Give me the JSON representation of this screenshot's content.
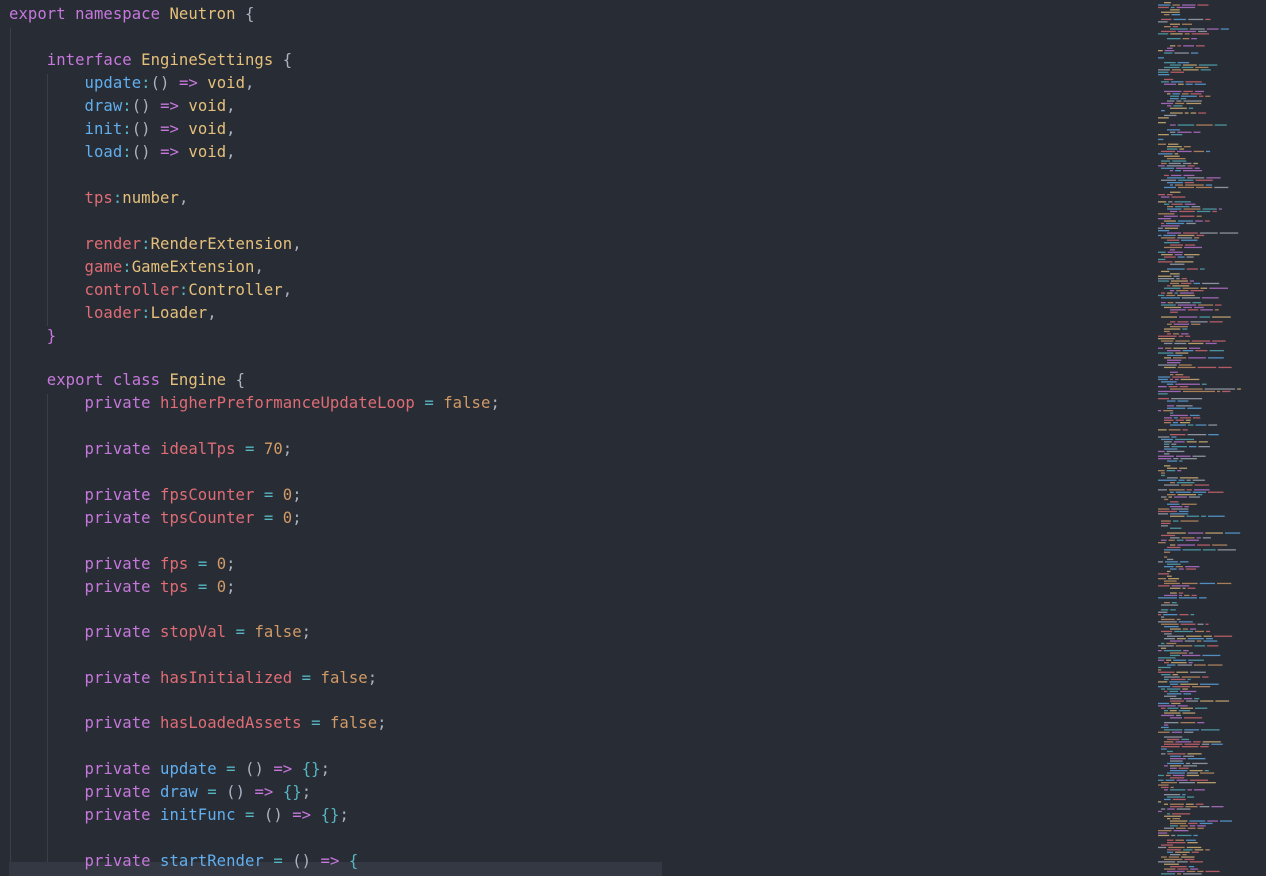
{
  "editor": {
    "language": "typescript",
    "lines": [
      [
        [
          "k",
          "export "
        ],
        [
          "k",
          "namespace "
        ],
        [
          "t",
          "Neutron "
        ],
        [
          "b",
          "{"
        ]
      ],
      [],
      [
        [
          "b",
          "    "
        ],
        [
          "k",
          "interface "
        ],
        [
          "t",
          "EngineSettings "
        ],
        [
          "b",
          "{"
        ]
      ],
      [
        [
          "b",
          "        "
        ],
        [
          "f",
          "update"
        ],
        [
          "o",
          ":"
        ],
        [
          "b",
          "() "
        ],
        [
          "k",
          "=>"
        ],
        [
          "b",
          " "
        ],
        [
          "t",
          "void"
        ],
        [
          "b",
          ","
        ]
      ],
      [
        [
          "b",
          "        "
        ],
        [
          "f",
          "draw"
        ],
        [
          "o",
          ":"
        ],
        [
          "b",
          "() "
        ],
        [
          "k",
          "=>"
        ],
        [
          "b",
          " "
        ],
        [
          "t",
          "void"
        ],
        [
          "b",
          ","
        ]
      ],
      [
        [
          "b",
          "        "
        ],
        [
          "f",
          "init"
        ],
        [
          "o",
          ":"
        ],
        [
          "b",
          "() "
        ],
        [
          "k",
          "=>"
        ],
        [
          "b",
          " "
        ],
        [
          "t",
          "void"
        ],
        [
          "b",
          ","
        ]
      ],
      [
        [
          "b",
          "        "
        ],
        [
          "f",
          "load"
        ],
        [
          "o",
          ":"
        ],
        [
          "b",
          "() "
        ],
        [
          "k",
          "=>"
        ],
        [
          "b",
          " "
        ],
        [
          "t",
          "void"
        ],
        [
          "b",
          ","
        ]
      ],
      [],
      [
        [
          "b",
          "        "
        ],
        [
          "p",
          "tps"
        ],
        [
          "o",
          ":"
        ],
        [
          "t",
          "number"
        ],
        [
          "b",
          ","
        ]
      ],
      [],
      [
        [
          "b",
          "        "
        ],
        [
          "p",
          "render"
        ],
        [
          "o",
          ":"
        ],
        [
          "t",
          "RenderExtension"
        ],
        [
          "b",
          ","
        ]
      ],
      [
        [
          "b",
          "        "
        ],
        [
          "p",
          "game"
        ],
        [
          "o",
          ":"
        ],
        [
          "t",
          "GameExtension"
        ],
        [
          "b",
          ","
        ]
      ],
      [
        [
          "b",
          "        "
        ],
        [
          "p",
          "controller"
        ],
        [
          "o",
          ":"
        ],
        [
          "t",
          "Controller"
        ],
        [
          "b",
          ","
        ]
      ],
      [
        [
          "b",
          "        "
        ],
        [
          "p",
          "loader"
        ],
        [
          "o",
          ":"
        ],
        [
          "t",
          "Loader"
        ],
        [
          "b",
          ","
        ]
      ],
      [
        [
          "b",
          "    "
        ],
        [
          "k",
          "}"
        ]
      ],
      [],
      [
        [
          "b",
          "    "
        ],
        [
          "k",
          "export "
        ],
        [
          "k",
          "class "
        ],
        [
          "t",
          "Engine "
        ],
        [
          "b",
          "{"
        ]
      ],
      [
        [
          "b",
          "        "
        ],
        [
          "k",
          "private "
        ],
        [
          "p",
          "higherPreformanceUpdateLoop"
        ],
        [
          "b",
          " "
        ],
        [
          "o",
          "="
        ],
        [
          "b",
          " "
        ],
        [
          "n",
          "false"
        ],
        [
          "b",
          ";"
        ]
      ],
      [],
      [
        [
          "b",
          "        "
        ],
        [
          "k",
          "private "
        ],
        [
          "p",
          "idealTps"
        ],
        [
          "b",
          " "
        ],
        [
          "o",
          "="
        ],
        [
          "b",
          " "
        ],
        [
          "n",
          "70"
        ],
        [
          "b",
          ";"
        ]
      ],
      [],
      [
        [
          "b",
          "        "
        ],
        [
          "k",
          "private "
        ],
        [
          "p",
          "fpsCounter"
        ],
        [
          "b",
          " "
        ],
        [
          "o",
          "="
        ],
        [
          "b",
          " "
        ],
        [
          "n",
          "0"
        ],
        [
          "b",
          ";"
        ]
      ],
      [
        [
          "b",
          "        "
        ],
        [
          "k",
          "private "
        ],
        [
          "p",
          "tpsCounter"
        ],
        [
          "b",
          " "
        ],
        [
          "o",
          "="
        ],
        [
          "b",
          " "
        ],
        [
          "n",
          "0"
        ],
        [
          "b",
          ";"
        ]
      ],
      [],
      [
        [
          "b",
          "        "
        ],
        [
          "k",
          "private "
        ],
        [
          "p",
          "fps"
        ],
        [
          "b",
          " "
        ],
        [
          "o",
          "="
        ],
        [
          "b",
          " "
        ],
        [
          "n",
          "0"
        ],
        [
          "b",
          ";"
        ]
      ],
      [
        [
          "b",
          "        "
        ],
        [
          "k",
          "private "
        ],
        [
          "p",
          "tps"
        ],
        [
          "b",
          " "
        ],
        [
          "o",
          "="
        ],
        [
          "b",
          " "
        ],
        [
          "n",
          "0"
        ],
        [
          "b",
          ";"
        ]
      ],
      [],
      [
        [
          "b",
          "        "
        ],
        [
          "k",
          "private "
        ],
        [
          "p",
          "stopVal"
        ],
        [
          "b",
          " "
        ],
        [
          "o",
          "="
        ],
        [
          "b",
          " "
        ],
        [
          "n",
          "false"
        ],
        [
          "b",
          ";"
        ]
      ],
      [],
      [
        [
          "b",
          "        "
        ],
        [
          "k",
          "private "
        ],
        [
          "p",
          "hasInitialized"
        ],
        [
          "b",
          " "
        ],
        [
          "o",
          "="
        ],
        [
          "b",
          " "
        ],
        [
          "n",
          "false"
        ],
        [
          "b",
          ";"
        ]
      ],
      [],
      [
        [
          "b",
          "        "
        ],
        [
          "k",
          "private "
        ],
        [
          "p",
          "hasLoadedAssets"
        ],
        [
          "b",
          " "
        ],
        [
          "o",
          "="
        ],
        [
          "b",
          " "
        ],
        [
          "n",
          "false"
        ],
        [
          "b",
          ";"
        ]
      ],
      [],
      [
        [
          "b",
          "        "
        ],
        [
          "k",
          "private "
        ],
        [
          "f",
          "update"
        ],
        [
          "b",
          " "
        ],
        [
          "o",
          "="
        ],
        [
          "b",
          " () "
        ],
        [
          "k",
          "=>"
        ],
        [
          "b",
          " "
        ],
        [
          "o",
          "{}"
        ],
        [
          "b",
          ";"
        ]
      ],
      [
        [
          "b",
          "        "
        ],
        [
          "k",
          "private "
        ],
        [
          "f",
          "draw"
        ],
        [
          "b",
          " "
        ],
        [
          "o",
          "="
        ],
        [
          "b",
          " () "
        ],
        [
          "k",
          "=>"
        ],
        [
          "b",
          " "
        ],
        [
          "o",
          "{}"
        ],
        [
          "b",
          ";"
        ]
      ],
      [
        [
          "b",
          "        "
        ],
        [
          "k",
          "private "
        ],
        [
          "f",
          "initFunc"
        ],
        [
          "b",
          " "
        ],
        [
          "o",
          "="
        ],
        [
          "b",
          " () "
        ],
        [
          "k",
          "=>"
        ],
        [
          "b",
          " "
        ],
        [
          "o",
          "{}"
        ],
        [
          "b",
          ";"
        ]
      ],
      [],
      [
        [
          "b",
          "        "
        ],
        [
          "k",
          "private "
        ],
        [
          "f",
          "startRender"
        ],
        [
          "b",
          " "
        ],
        [
          "o",
          "="
        ],
        [
          "b",
          " () "
        ],
        [
          "k",
          "=>"
        ],
        [
          "b",
          " "
        ],
        [
          "o",
          "{"
        ]
      ]
    ]
  },
  "colors": {
    "background": "#282c34",
    "keyword": "#c678dd",
    "type": "#e5c07b",
    "function": "#61afef",
    "property": "#e06c75",
    "number": "#d19a66",
    "operator": "#56b6c2",
    "text": "#abb2bf"
  }
}
